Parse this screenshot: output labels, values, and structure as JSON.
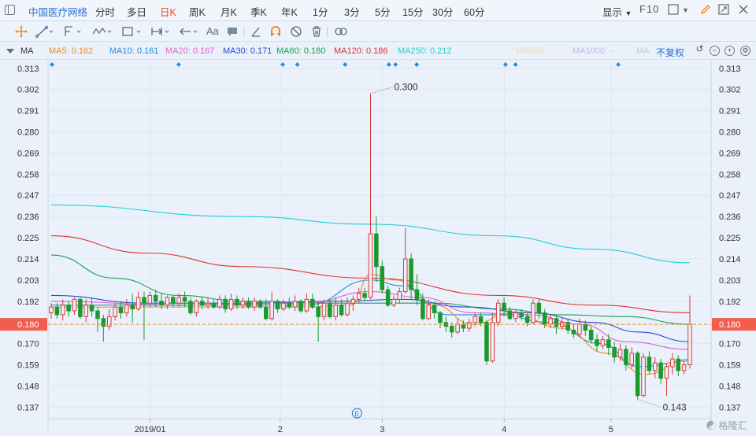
{
  "topbar": {
    "stock_name": "中国医疗网络",
    "periods": [
      {
        "label": "分时",
        "active": false
      },
      {
        "label": "多日",
        "active": false
      },
      {
        "label": "日K",
        "active": true
      },
      {
        "label": "周K",
        "active": false
      },
      {
        "label": "月K",
        "active": false
      },
      {
        "label": "季K",
        "active": false
      },
      {
        "label": "年K",
        "active": false
      },
      {
        "label": "1分",
        "active": false
      },
      {
        "label": "3分",
        "active": false
      },
      {
        "label": "5分",
        "active": false
      },
      {
        "label": "15分",
        "active": false
      },
      {
        "label": "30分",
        "active": false
      },
      {
        "label": "60分",
        "active": false
      }
    ],
    "display_label": "显示",
    "f10_label": "F10"
  },
  "toolbar": {
    "tools": [
      "crosshair",
      "line",
      "ray",
      "wave",
      "range",
      "arrow",
      "text",
      "comment",
      "pen",
      "magnet",
      "hide",
      "trash",
      "link"
    ],
    "text_tool_label": "Aa"
  },
  "ma_bar": {
    "label": "MA",
    "fq_label": "不复权",
    "items": [
      {
        "label": "MA5: 0.162",
        "color": "#f08a1e"
      },
      {
        "label": "MA10: 0.161",
        "color": "#2a8bd4"
      },
      {
        "label": "MA20: 0.167",
        "color": "#e25fd1"
      },
      {
        "label": "MA30: 0.171",
        "color": "#2a4ad4"
      },
      {
        "label": "MA60: 0.180",
        "color": "#1aa050"
      },
      {
        "label": "MA120: 0.186",
        "color": "#e0332f"
      },
      {
        "label": "MA250: 0.212",
        "color": "#22d0d8"
      },
      {
        "label": "MA500: -",
        "color": "#f4dab0"
      },
      {
        "label": "MA1000: -",
        "color": "#c7b6f2"
      },
      {
        "label": "MA",
        "color": "#c4ccd6"
      }
    ]
  },
  "chart_data": {
    "type": "candlestick",
    "ylim": [
      0.131,
      0.317
    ],
    "y_ticks": [
      0.313,
      0.302,
      0.291,
      0.28,
      0.269,
      0.258,
      0.247,
      0.236,
      0.225,
      0.214,
      0.203,
      0.192,
      0.18,
      0.17,
      0.159,
      0.148,
      0.137
    ],
    "x_labels": [
      {
        "label": "2019/01",
        "pos": 0.154
      },
      {
        "label": "2",
        "pos": 0.35
      },
      {
        "label": "3",
        "pos": 0.504
      },
      {
        "label": "4",
        "pos": 0.688
      },
      {
        "label": "5",
        "pos": 0.849
      }
    ],
    "current_price": "0.180",
    "max_label": "0.300",
    "min_label": "0.143",
    "event_marker": "E",
    "watermark": "格隆汇",
    "colors": {
      "up": "#d93a3a",
      "down": "#1a9a2c"
    },
    "candles": [
      [
        0.186,
        0.189,
        0.183,
        0.191
      ],
      [
        0.189,
        0.185,
        0.183,
        0.191
      ],
      [
        0.185,
        0.19,
        0.182,
        0.193
      ],
      [
        0.19,
        0.187,
        0.184,
        0.192
      ],
      [
        0.187,
        0.193,
        0.185,
        0.194
      ],
      [
        0.193,
        0.184,
        0.183,
        0.194
      ],
      [
        0.184,
        0.19,
        0.181,
        0.193
      ],
      [
        0.19,
        0.187,
        0.184,
        0.194
      ],
      [
        0.187,
        0.183,
        0.176,
        0.189
      ],
      [
        0.183,
        0.179,
        0.171,
        0.185
      ],
      [
        0.179,
        0.184,
        0.177,
        0.188
      ],
      [
        0.184,
        0.189,
        0.182,
        0.191
      ],
      [
        0.189,
        0.186,
        0.183,
        0.192
      ],
      [
        0.186,
        0.19,
        0.184,
        0.193
      ],
      [
        0.19,
        0.188,
        0.181,
        0.196
      ],
      [
        0.188,
        0.194,
        0.187,
        0.197
      ],
      [
        0.194,
        0.191,
        0.172,
        0.197
      ],
      [
        0.191,
        0.195,
        0.189,
        0.197
      ],
      [
        0.195,
        0.192,
        0.189,
        0.198
      ],
      [
        0.192,
        0.19,
        0.188,
        0.196
      ],
      [
        0.19,
        0.194,
        0.188,
        0.195
      ],
      [
        0.194,
        0.191,
        0.189,
        0.195
      ],
      [
        0.191,
        0.194,
        0.189,
        0.196
      ],
      [
        0.194,
        0.192,
        0.189,
        0.197
      ],
      [
        0.192,
        0.186,
        0.185,
        0.194
      ],
      [
        0.186,
        0.192,
        0.184,
        0.193
      ],
      [
        0.192,
        0.19,
        0.188,
        0.194
      ],
      [
        0.19,
        0.191,
        0.188,
        0.194
      ],
      [
        0.191,
        0.189,
        0.188,
        0.193
      ],
      [
        0.189,
        0.193,
        0.188,
        0.195
      ],
      [
        0.193,
        0.188,
        0.186,
        0.195
      ],
      [
        0.188,
        0.193,
        0.187,
        0.196
      ],
      [
        0.193,
        0.19,
        0.188,
        0.195
      ],
      [
        0.19,
        0.192,
        0.188,
        0.194
      ],
      [
        0.192,
        0.189,
        0.188,
        0.194
      ],
      [
        0.189,
        0.192,
        0.187,
        0.194
      ],
      [
        0.192,
        0.189,
        0.188,
        0.193
      ],
      [
        0.189,
        0.183,
        0.182,
        0.193
      ],
      [
        0.183,
        0.192,
        0.182,
        0.197
      ],
      [
        0.192,
        0.188,
        0.186,
        0.193
      ],
      [
        0.188,
        0.191,
        0.187,
        0.193
      ],
      [
        0.191,
        0.189,
        0.188,
        0.194
      ],
      [
        0.189,
        0.192,
        0.187,
        0.195
      ],
      [
        0.192,
        0.187,
        0.186,
        0.193
      ],
      [
        0.187,
        0.193,
        0.186,
        0.196
      ],
      [
        0.193,
        0.189,
        0.188,
        0.196
      ],
      [
        0.189,
        0.184,
        0.171,
        0.191
      ],
      [
        0.184,
        0.191,
        0.182,
        0.193
      ],
      [
        0.191,
        0.184,
        0.183,
        0.193
      ],
      [
        0.184,
        0.19,
        0.182,
        0.194
      ],
      [
        0.19,
        0.185,
        0.184,
        0.193
      ],
      [
        0.185,
        0.191,
        0.184,
        0.194
      ],
      [
        0.191,
        0.193,
        0.187,
        0.195
      ],
      [
        0.193,
        0.196,
        0.191,
        0.199
      ],
      [
        0.196,
        0.194,
        0.192,
        0.199
      ],
      [
        0.194,
        0.227,
        0.193,
        0.3
      ],
      [
        0.227,
        0.21,
        0.202,
        0.236
      ],
      [
        0.21,
        0.198,
        0.196,
        0.213
      ],
      [
        0.198,
        0.19,
        0.189,
        0.2
      ],
      [
        0.19,
        0.193,
        0.189,
        0.195
      ],
      [
        0.193,
        0.197,
        0.191,
        0.199
      ],
      [
        0.197,
        0.214,
        0.196,
        0.23
      ],
      [
        0.214,
        0.198,
        0.193,
        0.217
      ],
      [
        0.198,
        0.193,
        0.19,
        0.206
      ],
      [
        0.193,
        0.183,
        0.182,
        0.196
      ],
      [
        0.183,
        0.19,
        0.182,
        0.193
      ],
      [
        0.19,
        0.186,
        0.183,
        0.192
      ],
      [
        0.186,
        0.181,
        0.178,
        0.187
      ],
      [
        0.181,
        0.179,
        0.176,
        0.184
      ],
      [
        0.179,
        0.176,
        0.173,
        0.181
      ],
      [
        0.176,
        0.18,
        0.175,
        0.183
      ],
      [
        0.18,
        0.178,
        0.176,
        0.182
      ],
      [
        0.178,
        0.181,
        0.176,
        0.183
      ],
      [
        0.181,
        0.184,
        0.179,
        0.186
      ],
      [
        0.184,
        0.181,
        0.179,
        0.186
      ],
      [
        0.181,
        0.161,
        0.159,
        0.182
      ],
      [
        0.161,
        0.181,
        0.16,
        0.186
      ],
      [
        0.181,
        0.191,
        0.179,
        0.193
      ],
      [
        0.191,
        0.187,
        0.184,
        0.194
      ],
      [
        0.187,
        0.183,
        0.182,
        0.189
      ],
      [
        0.183,
        0.186,
        0.181,
        0.188
      ],
      [
        0.186,
        0.184,
        0.182,
        0.188
      ],
      [
        0.184,
        0.181,
        0.179,
        0.186
      ],
      [
        0.181,
        0.191,
        0.18,
        0.193
      ],
      [
        0.191,
        0.186,
        0.183,
        0.193
      ],
      [
        0.186,
        0.18,
        0.178,
        0.188
      ],
      [
        0.18,
        0.183,
        0.178,
        0.185
      ],
      [
        0.183,
        0.179,
        0.175,
        0.185
      ],
      [
        0.179,
        0.181,
        0.177,
        0.183
      ],
      [
        0.181,
        0.177,
        0.175,
        0.183
      ],
      [
        0.177,
        0.175,
        0.173,
        0.18
      ],
      [
        0.175,
        0.18,
        0.174,
        0.183
      ],
      [
        0.18,
        0.177,
        0.174,
        0.182
      ],
      [
        0.177,
        0.172,
        0.17,
        0.179
      ],
      [
        0.172,
        0.169,
        0.166,
        0.175
      ],
      [
        0.169,
        0.172,
        0.167,
        0.174
      ],
      [
        0.172,
        0.168,
        0.164,
        0.175
      ],
      [
        0.168,
        0.163,
        0.16,
        0.171
      ],
      [
        0.163,
        0.167,
        0.161,
        0.17
      ],
      [
        0.167,
        0.159,
        0.156,
        0.169
      ],
      [
        0.159,
        0.165,
        0.157,
        0.168
      ],
      [
        0.165,
        0.143,
        0.141,
        0.166
      ],
      [
        0.143,
        0.163,
        0.142,
        0.165
      ],
      [
        0.163,
        0.156,
        0.154,
        0.166
      ],
      [
        0.156,
        0.16,
        0.152,
        0.163
      ],
      [
        0.16,
        0.152,
        0.149,
        0.162
      ],
      [
        0.152,
        0.158,
        0.143,
        0.16
      ],
      [
        0.158,
        0.162,
        0.154,
        0.165
      ],
      [
        0.162,
        0.156,
        0.153,
        0.164
      ],
      [
        0.156,
        0.159,
        0.154,
        0.161
      ],
      [
        0.159,
        0.18,
        0.157,
        0.195
      ]
    ],
    "ma_lines": [
      {
        "name": "MA250",
        "color": "#22d0d8",
        "anchors": [
          [
            0,
            0.242
          ],
          [
            0.3,
            0.236
          ],
          [
            0.5,
            0.232
          ],
          [
            0.7,
            0.226
          ],
          [
            0.85,
            0.219
          ],
          [
            1,
            0.212
          ]
        ]
      },
      {
        "name": "MA120",
        "color": "#e0332f",
        "anchors": [
          [
            0,
            0.226
          ],
          [
            0.15,
            0.217
          ],
          [
            0.3,
            0.21
          ],
          [
            0.5,
            0.204
          ],
          [
            0.7,
            0.195
          ],
          [
            0.85,
            0.19
          ],
          [
            1,
            0.186
          ]
        ]
      },
      {
        "name": "MA60",
        "color": "#1aa050",
        "anchors": [
          [
            0,
            0.216
          ],
          [
            0.1,
            0.204
          ],
          [
            0.2,
            0.195
          ],
          [
            0.3,
            0.192
          ],
          [
            0.45,
            0.191
          ],
          [
            0.6,
            0.191
          ],
          [
            0.7,
            0.188
          ],
          [
            0.8,
            0.185
          ],
          [
            0.9,
            0.184
          ],
          [
            1,
            0.18
          ]
        ]
      },
      {
        "name": "MA30",
        "color": "#2a4ad4",
        "anchors": [
          [
            0,
            0.195
          ],
          [
            0.15,
            0.191
          ],
          [
            0.3,
            0.191
          ],
          [
            0.45,
            0.192
          ],
          [
            0.55,
            0.193
          ],
          [
            0.65,
            0.189
          ],
          [
            0.75,
            0.186
          ],
          [
            0.85,
            0.181
          ],
          [
            0.92,
            0.176
          ],
          [
            1,
            0.171
          ]
        ]
      },
      {
        "name": "MA20",
        "color": "#e25fd1",
        "anchors": [
          [
            0,
            0.192
          ],
          [
            0.2,
            0.19
          ],
          [
            0.4,
            0.191
          ],
          [
            0.5,
            0.197
          ],
          [
            0.58,
            0.194
          ],
          [
            0.66,
            0.186
          ],
          [
            0.75,
            0.185
          ],
          [
            0.83,
            0.18
          ],
          [
            0.9,
            0.171
          ],
          [
            1,
            0.167
          ]
        ]
      },
      {
        "name": "MA10",
        "color": "#2a8bd4",
        "anchors": [
          [
            0,
            0.19
          ],
          [
            0.2,
            0.19
          ],
          [
            0.4,
            0.19
          ],
          [
            0.5,
            0.203
          ],
          [
            0.55,
            0.2
          ],
          [
            0.62,
            0.185
          ],
          [
            0.7,
            0.185
          ],
          [
            0.78,
            0.181
          ],
          [
            0.86,
            0.17
          ],
          [
            0.92,
            0.158
          ],
          [
            1,
            0.161
          ]
        ]
      },
      {
        "name": "MA5",
        "color": "#f08a1e",
        "anchors": [
          [
            0,
            0.189
          ],
          [
            0.2,
            0.189
          ],
          [
            0.4,
            0.189
          ],
          [
            0.47,
            0.19
          ],
          [
            0.5,
            0.206
          ],
          [
            0.54,
            0.203
          ],
          [
            0.6,
            0.19
          ],
          [
            0.66,
            0.18
          ],
          [
            0.72,
            0.186
          ],
          [
            0.8,
            0.178
          ],
          [
            0.87,
            0.165
          ],
          [
            0.93,
            0.154
          ],
          [
            1,
            0.162
          ]
        ]
      }
    ],
    "event_dots": [
      0.006,
      0.197,
      0.354,
      0.376,
      0.448,
      0.514,
      0.524,
      0.556,
      0.69,
      0.705,
      0.86
    ]
  }
}
